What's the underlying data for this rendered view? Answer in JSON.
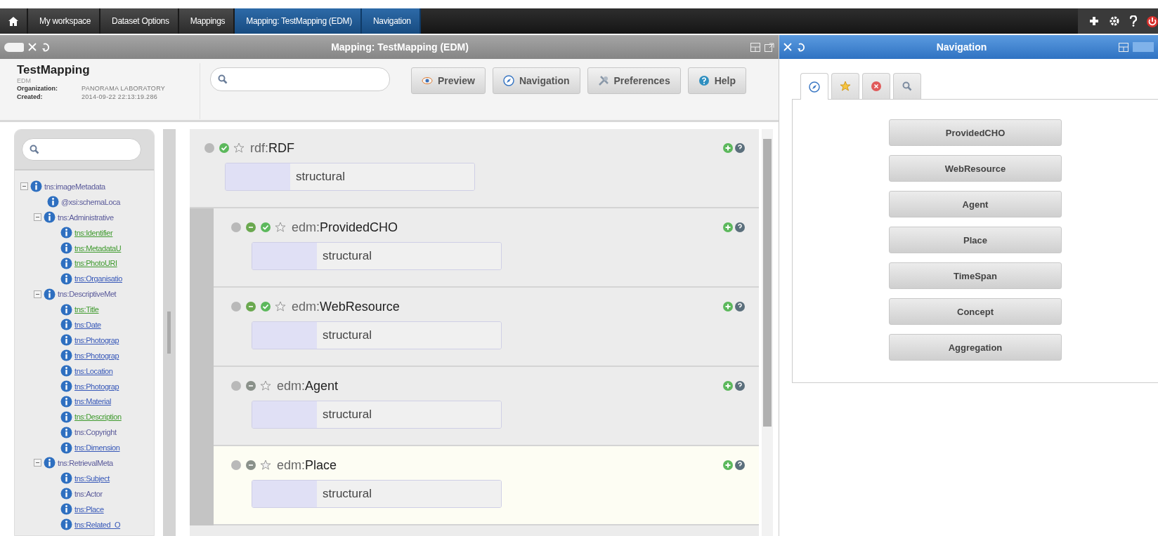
{
  "breadcrumb": [
    {
      "label": "My workspace",
      "open": false
    },
    {
      "label": "Dataset Options",
      "open": false
    },
    {
      "label": "Mappings",
      "open": false
    },
    {
      "label": "Mapping: TestMapping (EDM)",
      "open": true
    },
    {
      "label": "Navigation",
      "open": true
    }
  ],
  "mapping_panel": {
    "title": "Mapping: TestMapping (EDM)",
    "name": "TestMapping",
    "schema": "EDM",
    "info": [
      {
        "label": "Organization:",
        "value": "PANORAMA LABORATORY"
      },
      {
        "label": "Created:",
        "value": "2014-09-22 22:13:19.286"
      }
    ],
    "buttons": [
      {
        "label": "Preview"
      },
      {
        "label": "Navigation"
      },
      {
        "label": "Preferences"
      },
      {
        "label": "Help"
      }
    ],
    "tree": [
      {
        "label": "tns:imageMetadata",
        "kind": "plain",
        "expanded": true,
        "children": [
          {
            "label": "@xsi:schemaLoca",
            "kind": "plain"
          },
          {
            "label": "tns:Administrative",
            "kind": "plain",
            "expanded": true,
            "children": [
              {
                "label": "tns:Identifier",
                "kind": "mapped"
              },
              {
                "label": "tns:MetadataU",
                "kind": "mapped"
              },
              {
                "label": "tns:PhotoURI",
                "kind": "mapped"
              },
              {
                "label": "tns:Organisatio",
                "kind": "link"
              }
            ]
          },
          {
            "label": "tns:DescriptiveMet",
            "kind": "plain",
            "expanded": true,
            "children": [
              {
                "label": "tns:Title",
                "kind": "mapped"
              },
              {
                "label": "tns:Date",
                "kind": "link"
              },
              {
                "label": "tns:Photograp",
                "kind": "link"
              },
              {
                "label": "tns:Photograp",
                "kind": "link"
              },
              {
                "label": "tns:Location",
                "kind": "link"
              },
              {
                "label": "tns:Photograp",
                "kind": "link"
              },
              {
                "label": "tns:Material",
                "kind": "link"
              },
              {
                "label": "tns:Description",
                "kind": "mapped"
              },
              {
                "label": "tns:Copyright",
                "kind": "plain"
              },
              {
                "label": "tns:Dimension",
                "kind": "link"
              }
            ]
          },
          {
            "label": "tns:RetrievalMeta",
            "kind": "plain",
            "expanded": true,
            "children": [
              {
                "label": "tns:Subject",
                "kind": "link"
              },
              {
                "label": "tns:Actor",
                "kind": "plain"
              },
              {
                "label": "tns:Place",
                "kind": "link"
              },
              {
                "label": "tns:Related_O",
                "kind": "link"
              }
            ]
          }
        ]
      }
    ],
    "mapping": {
      "prefix": "rdf:",
      "name": "RDF",
      "icons": [
        {
          "kind": "grey"
        },
        {
          "kind": "check"
        }
      ],
      "value": "structural",
      "highlighted": false,
      "children": [
        {
          "prefix": "edm:",
          "name": "ProvidedCHO",
          "icons": [
            {
              "kind": "grey"
            },
            {
              "kind": "dash"
            },
            {
              "kind": "check"
            }
          ],
          "value": "structural",
          "highlighted": false
        },
        {
          "prefix": "edm:",
          "name": "WebResource",
          "icons": [
            {
              "kind": "grey"
            },
            {
              "kind": "dash"
            },
            {
              "kind": "check"
            }
          ],
          "value": "structural",
          "highlighted": false
        },
        {
          "prefix": "edm:",
          "name": "Agent",
          "icons": [
            {
              "kind": "grey"
            },
            {
              "kind": "dark"
            }
          ],
          "value": "structural",
          "highlighted": false
        },
        {
          "prefix": "edm:",
          "name": "Place",
          "icons": [
            {
              "kind": "grey"
            },
            {
              "kind": "dark"
            }
          ],
          "value": "structural",
          "highlighted": true
        }
      ]
    }
  },
  "navigation_panel": {
    "title": "Navigation",
    "tabs": [
      {
        "selected": true
      },
      {
        "selected": false
      },
      {
        "selected": false
      },
      {
        "selected": false
      }
    ],
    "buttons": [
      "ProvidedCHO",
      "WebResource",
      "Agent",
      "Place",
      "TimeSpan",
      "Concept",
      "Aggregation"
    ]
  }
}
